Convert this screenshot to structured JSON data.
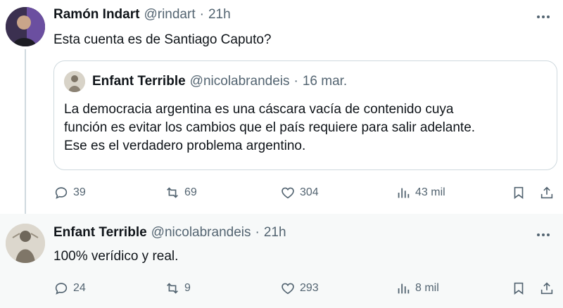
{
  "tweets": [
    {
      "author_name": "Ramón Indart",
      "handle": "@rindart",
      "separator": "·",
      "time": "21h",
      "text": "Esta cuenta es de Santiago Caputo?",
      "quote": {
        "author_name": "Enfant Terrible",
        "handle": "@nicolabrandeis",
        "separator": "·",
        "time": "16 mar.",
        "lines": [
          "La democracia argentina es una cáscara vacía de contenido cuya",
          "función es evitar los cambios que el país requiere para salir adelante.",
          "Ese es el verdadero problema argentino."
        ]
      },
      "stats": {
        "replies": "39",
        "retweets": "69",
        "likes": "304",
        "views": "43 mil"
      }
    },
    {
      "author_name": "Enfant Terrible",
      "handle": "@nicolabrandeis",
      "separator": "·",
      "time": "21h",
      "text": "100% verídico y real.",
      "stats": {
        "replies": "24",
        "retweets": "9",
        "likes": "293",
        "views": "8 mil"
      }
    }
  ],
  "icons": {
    "reply": "reply-icon",
    "retweet": "retweet-icon",
    "like": "heart-icon",
    "views": "views-icon",
    "bookmark": "bookmark-icon",
    "share": "share-icon",
    "more": "more-icon"
  },
  "colors": {
    "text": "#0f1419",
    "secondary": "#536471",
    "border": "#cfd9de",
    "highlight_bg": "#f7f9f9"
  }
}
